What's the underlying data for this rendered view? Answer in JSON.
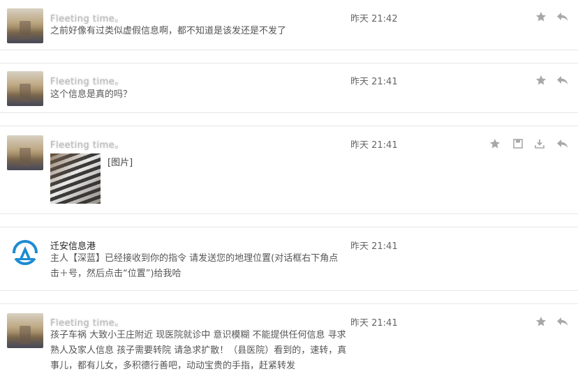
{
  "messages": [
    {
      "sender": "Fleeting time。",
      "text": "之前好像有过类似虚假信息啊，都不知道是该发还是不发了",
      "time": "昨天 21:42",
      "actions": [
        "star-icon",
        "reply-icon"
      ]
    },
    {
      "sender": "Fleeting time。",
      "text": "这个信息是真的吗？",
      "time": "昨天 21:41",
      "actions": [
        "star-icon",
        "reply-icon"
      ]
    },
    {
      "sender": "Fleeting time。",
      "image_label": "[图片]",
      "time": "昨天 21:41",
      "actions": [
        "star-icon",
        "save-icon",
        "download-icon",
        "reply-icon"
      ]
    },
    {
      "sender": "迁安信息港",
      "text": "主人【深蓝】已经接收到你的指令 请发送您的地理位置(对话框右下角点击＋号，然后点击“位置”)给我哈",
      "time": "昨天 21:41",
      "actions": []
    },
    {
      "sender": "Fleeting time。",
      "text": "孩子车祸 大致小王庄附近 现医院就诊中 意识模糊 不能提供任何信息 寻求熟人及家人信息 孩子需要转院 请急求扩散！（县医院）看到的，速转，真事儿，都有儿女，多积德行善吧，动动宝贵的手指，赶紧转发",
      "time": "昨天 21:41",
      "actions": [
        "star-icon",
        "reply-icon"
      ]
    }
  ],
  "colors": {
    "icon": "#9a9a9a",
    "separator": "#e6e6e6",
    "logo_blue": "#1d8bd3"
  }
}
